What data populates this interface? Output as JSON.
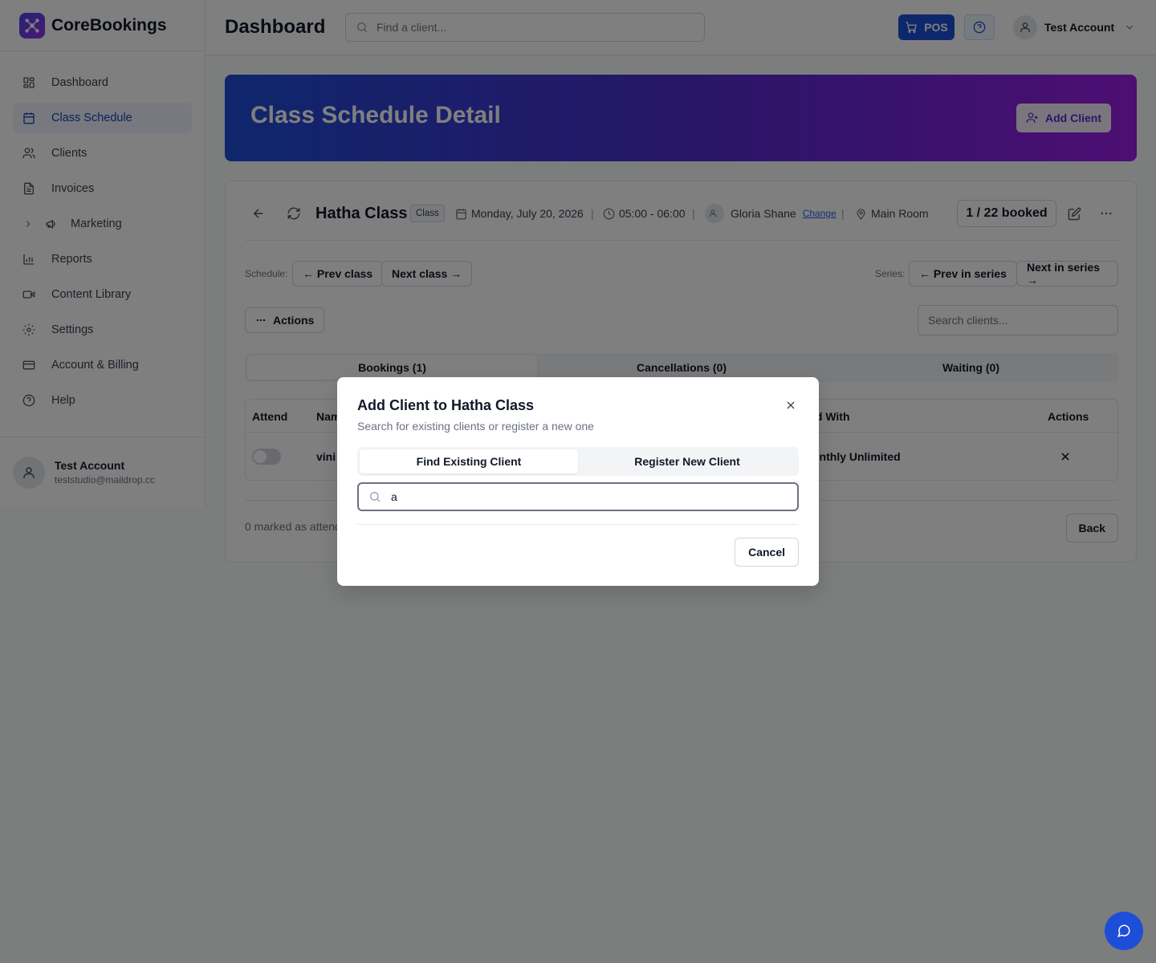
{
  "brand": {
    "name": "CoreBookings"
  },
  "sidebar": {
    "items": [
      {
        "label": "Dashboard"
      },
      {
        "label": "Class Schedule"
      },
      {
        "label": "Clients"
      },
      {
        "label": "Invoices"
      },
      {
        "label": "Marketing"
      },
      {
        "label": "Reports"
      },
      {
        "label": "Content Library"
      },
      {
        "label": "Settings"
      },
      {
        "label": "Account & Billing"
      },
      {
        "label": "Help"
      }
    ],
    "active_index": 1,
    "user": {
      "name": "Test Account",
      "email": "teststudio@maildrop.cc"
    }
  },
  "header": {
    "title": "Dashboard",
    "search_placeholder": "Find a client...",
    "pos_label": "POS",
    "account_name": "Test Account"
  },
  "banner": {
    "title": "Class Schedule Detail",
    "add_client_label": "Add Client"
  },
  "class_detail": {
    "name": "Hatha Class",
    "type_badge": "Class",
    "date": "Monday, July 20, 2026",
    "time": "05:00 - 06:00",
    "instructor": "Gloria Shane",
    "change_label": "Change",
    "room": "Main Room",
    "booked": "1 / 22 booked"
  },
  "navigation": {
    "schedule_label": "Schedule:",
    "prev_class": "← Prev class",
    "next_class": "Next class →",
    "series_label": "Series:",
    "prev_series": "← Prev in series",
    "next_series": "Next in series →"
  },
  "toolbar": {
    "actions_label": "Actions",
    "search_placeholder": "Search clients..."
  },
  "tabs": [
    {
      "label": "Bookings (1)"
    },
    {
      "label": "Cancellations (0)"
    },
    {
      "label": "Waiting (0)"
    }
  ],
  "table": {
    "headers": {
      "attend": "Attend",
      "name": "Nam",
      "paid_with": "id With",
      "actions": "Actions"
    },
    "rows": [
      {
        "name": "vini",
        "paid_with": "onthly Unlimited"
      }
    ]
  },
  "footer": {
    "marked_text": "0 marked as attend",
    "back_label": "Back"
  },
  "modal": {
    "title": "Add Client to Hatha Class",
    "subtitle": "Search for existing clients or register a new one",
    "tab_find": "Find Existing Client",
    "tab_register": "Register New Client",
    "search_value": "a",
    "cancel_label": "Cancel"
  }
}
